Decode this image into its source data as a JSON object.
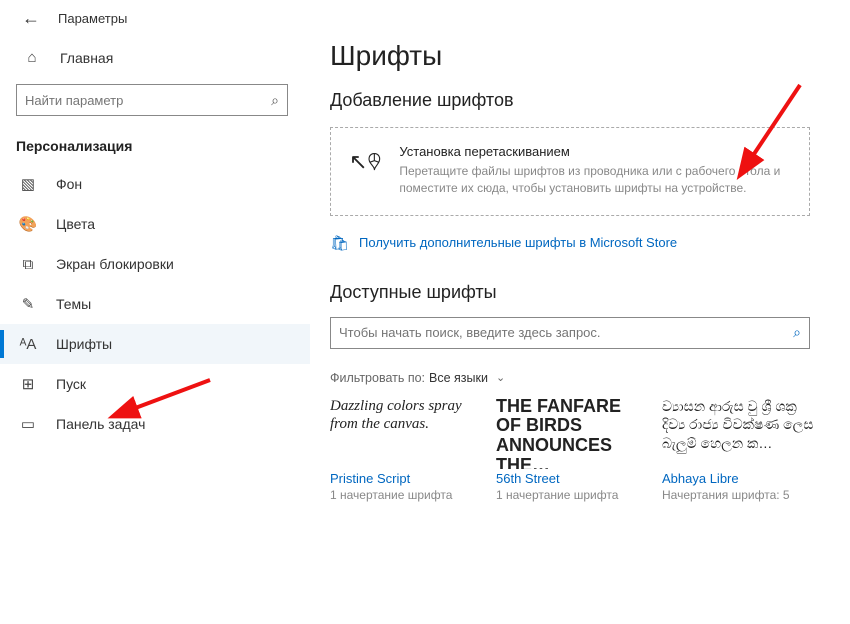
{
  "window": {
    "title": "Параметры"
  },
  "home": {
    "label": "Главная"
  },
  "search": {
    "placeholder": "Найти параметр"
  },
  "section": "Персонализация",
  "nav": [
    {
      "id": "background",
      "label": "Фон",
      "icon": "▧"
    },
    {
      "id": "colors",
      "label": "Цвета",
      "icon": "🎨"
    },
    {
      "id": "lockscreen",
      "label": "Экран блокировки",
      "icon": "⧉"
    },
    {
      "id": "themes",
      "label": "Темы",
      "icon": "✎"
    },
    {
      "id": "fonts",
      "label": "Шрифты",
      "icon": "ᴬA",
      "active": true
    },
    {
      "id": "start",
      "label": "Пуск",
      "icon": "⊞"
    },
    {
      "id": "taskbar",
      "label": "Панель задач",
      "icon": "▭"
    }
  ],
  "page": {
    "title": "Шрифты",
    "add_section": "Добавление шрифтов",
    "dropzone": {
      "title": "Установка перетаскиванием",
      "desc": "Перетащите файлы шрифтов из проводника или с рабочего стола и поместите их сюда, чтобы установить шрифты на устройстве."
    },
    "store_link": "Получить дополнительные шрифты в Microsoft Store",
    "available_section": "Доступные шрифты",
    "font_search_placeholder": "Чтобы начать поиск, введите здесь запрос.",
    "filter_label": "Фильтровать по:",
    "filter_value": "Все языки"
  },
  "fonts": [
    {
      "preview": "Dazzling colors spray from the canvas.",
      "name": "Pristine Script",
      "faces": "1 начертание шрифта",
      "style": "script"
    },
    {
      "preview": "THE FANFARE OF BIRDS ANNOUNCES THE…",
      "name": "56th Street",
      "faces": "1 начертание шрифта",
      "style": "condensed"
    },
    {
      "preview": "ව්‍යාසන ආරුස වු ශ්‍රී ශක්‍ර දිව්‍ය රාජ්‍ය විවක්ෂණ ලෙස බැලුම් හෙලන ක…",
      "name": "Abhaya Libre",
      "faces": "Начертания шрифта: 5",
      "style": "foreign"
    }
  ]
}
